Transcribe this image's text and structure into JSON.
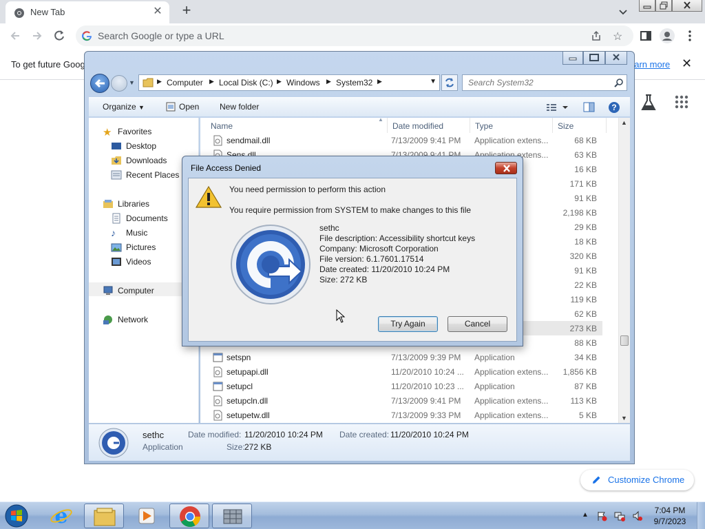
{
  "chrome": {
    "tab_title": "New Tab",
    "omnibox_placeholder": "Search Google or type a URL",
    "info_text": "To get future Goog",
    "learn_more": "earn more",
    "customize_label": "Customize Chrome"
  },
  "explorer": {
    "breadcrumbs": [
      "Computer",
      "Local Disk (C:)",
      "Windows",
      "System32"
    ],
    "search_placeholder": "Search System32",
    "toolbar": {
      "organize": "Organize",
      "open": "Open",
      "new_folder": "New folder"
    },
    "nav": {
      "favorites": "Favorites",
      "desktop": "Desktop",
      "downloads": "Downloads",
      "recent_places": "Recent Places",
      "libraries": "Libraries",
      "documents": "Documents",
      "music": "Music",
      "pictures": "Pictures",
      "videos": "Videos",
      "computer": "Computer",
      "network": "Network"
    },
    "columns": {
      "name": "Name",
      "date": "Date modified",
      "type": "Type",
      "size": "Size"
    },
    "rows": [
      {
        "name": "sendmail.dll",
        "date": "7/13/2009 9:41 PM",
        "type": "Application extens...",
        "size": "68 KB"
      },
      {
        "name": "Sens.dll",
        "date": "7/13/2009 9:41 PM",
        "type": "Application extens...",
        "size": "63 KB"
      },
      {
        "name": "",
        "date": "",
        "type": "extens...",
        "size": "16 KB"
      },
      {
        "name": "",
        "date": "",
        "type": "extens...",
        "size": "171 KB"
      },
      {
        "name": "",
        "date": "",
        "type": "extens...",
        "size": "91 KB"
      },
      {
        "name": "",
        "date": "",
        "type": "extens...",
        "size": "2,198 KB"
      },
      {
        "name": "",
        "date": "",
        "type": "extens...",
        "size": "29 KB"
      },
      {
        "name": "",
        "date": "",
        "type": "extens...",
        "size": "18 KB"
      },
      {
        "name": "",
        "date": "",
        "type": "",
        "size": "320 KB"
      },
      {
        "name": "",
        "date": "",
        "type": "mm...",
        "size": "91 KB"
      },
      {
        "name": "",
        "date": "",
        "type": "extens...",
        "size": "22 KB"
      },
      {
        "name": "",
        "date": "",
        "type": "extens...",
        "size": "119 KB"
      },
      {
        "name": "",
        "date": "",
        "type": "extens...",
        "size": "62 KB"
      },
      {
        "name": "",
        "date": "",
        "type": "",
        "size": "273 KB"
      },
      {
        "name": "",
        "date": "",
        "type": "",
        "size": "88 KB"
      },
      {
        "name": "setspn",
        "date": "7/13/2009 9:39 PM",
        "type": "Application",
        "size": "34 KB"
      },
      {
        "name": "setupapi.dll",
        "date": "11/20/2010 10:24 ...",
        "type": "Application extens...",
        "size": "1,856 KB"
      },
      {
        "name": "setupcl",
        "date": "11/20/2010 10:23 ...",
        "type": "Application",
        "size": "87 KB"
      },
      {
        "name": "setupcln.dll",
        "date": "7/13/2009 9:41 PM",
        "type": "Application extens...",
        "size": "113 KB"
      },
      {
        "name": "setupetw.dll",
        "date": "7/13/2009 9:33 PM",
        "type": "Application extens...",
        "size": "5 KB"
      }
    ],
    "details": {
      "name": "sethc",
      "kind": "Application",
      "date_modified_label": "Date modified:",
      "date_modified": "11/20/2010 10:24 PM",
      "date_created_label": "Date created:",
      "date_created": "11/20/2010 10:24 PM",
      "size_label": "Size:",
      "size": "272 KB"
    }
  },
  "dialog": {
    "title": "File Access Denied",
    "heading": "You need permission to perform this action",
    "message": "You require permission from SYSTEM to make changes to this file",
    "file_name": "sethc",
    "file_description": "File description: Accessibility shortcut keys",
    "company": "Company: Microsoft Corporation",
    "version": "File version: 6.1.7601.17514",
    "created": "Date created: 11/20/2010 10:24 PM",
    "size": "Size: 272 KB",
    "try_again": "Try Again",
    "cancel": "Cancel"
  },
  "taskbar": {
    "time": "7:04 PM",
    "date": "9/7/2023",
    "pinned": [
      "internet-explorer-icon",
      "explorer-folder-icon",
      "media-player-icon",
      "chrome-icon",
      "app-grid-icon"
    ]
  }
}
